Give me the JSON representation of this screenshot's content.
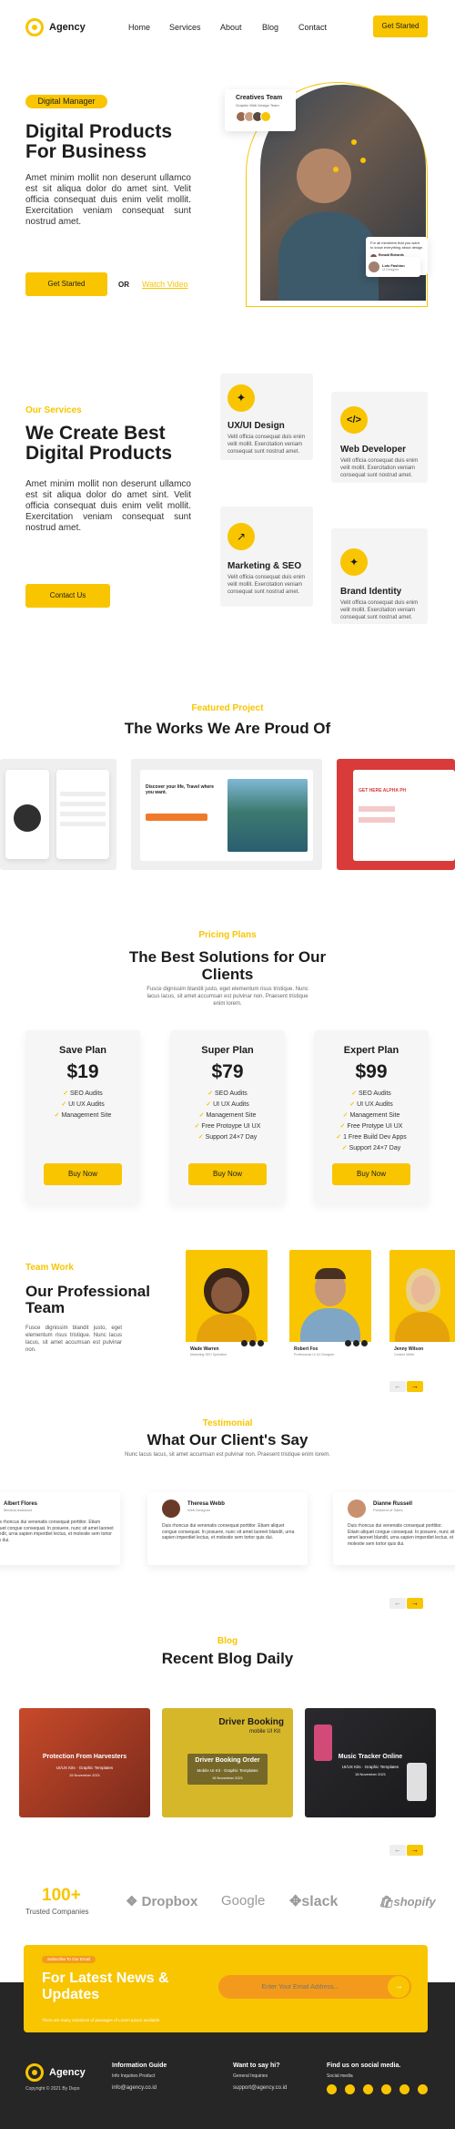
{
  "nav": {
    "brand": "Agency",
    "links": [
      "Home",
      "Services",
      "About",
      "Blog",
      "Contact"
    ],
    "cta": "Get Started"
  },
  "hero": {
    "badge": "Digital Manager",
    "title_line1": "Digital Products",
    "title_line2": "For Business",
    "description": "Amet minim mollit non deserunt ullamco est sit aliqua dolor do amet sint. Velit officia consequat duis enim velit mollit. Exercitation veniam consequat sunt nostrud amet.",
    "primary_btn": "Get Started",
    "or": "OR",
    "video_link": "Watch Video",
    "team_card_title": "Creatives Team",
    "team_card_subtitle": "Graphic Web Design Team",
    "quote_text": "For all members that you want to know everything about design",
    "quote_name": "Ronald Richards",
    "quote_role": "Designer",
    "small_card_name": "Lois Fashion",
    "small_card_role": "Ui Designer"
  },
  "services": {
    "eyebrow": "Our Services",
    "title_line1": "We Create Best",
    "title_line2": "Digital Products",
    "description": "Amet minim mollit non deserunt ullamco est sit aliqua dolor do amet sint. Velit officia consequat duis enim velit mollit. Exercitation veniam consequat sunt nostrud amet.",
    "cta": "Contact Us",
    "items": [
      {
        "title": "UX/UI Design",
        "desc": "Velit officia consequat duis enim velit mollit. Exercitation veniam consequat sunt nostrud amet."
      },
      {
        "title": "Web Developer",
        "desc": "Velit officia consequat duis enim velit mollit. Exercitation veniam consequat sunt nostrud amet."
      },
      {
        "title": "Marketing & SEO",
        "desc": "Velit officia consequat duis enim velit mollit. Exercitation veniam consequat sunt nostrud amet."
      },
      {
        "title": "Brand Identity",
        "desc": "Velit officia consequat duis enim velit mollit. Exercitation veniam consequat sunt nostrud amet."
      }
    ]
  },
  "works": {
    "eyebrow": "Featured Project",
    "title": "The Works We Are Proud Of",
    "card2_heading": "Discover your life, Travel where you want.",
    "card3_heading": "GET HERE ALPHA PH"
  },
  "pricing": {
    "eyebrow": "Pricing Plans",
    "title_line1": "The Best Solutions for Our",
    "title_line2": "Clients",
    "description": "Fusce dignissim blandit justo, eget elementum risus tristique. Nunc lacus lacus, sit amet accumsan est pulvinar non. Praesent tristique enim lorem.",
    "plans": [
      {
        "name": "Save Plan",
        "price": "$19",
        "features": [
          "SEO Audits",
          "UI UX Audits",
          "Management Site"
        ],
        "button": "Buy Now"
      },
      {
        "name": "Super Plan",
        "price": "$79",
        "features": [
          "SEO Audits",
          "UI UX Audits",
          "Management Site",
          "Free Protoype UI UX",
          "Support 24×7 Day"
        ],
        "button": "Buy Now"
      },
      {
        "name": "Expert Plan",
        "price": "$99",
        "features": [
          "SEO Audits",
          "UI UX Audits",
          "Management Site",
          "Free Protype UI UX",
          "1 Free Build Dev Apps",
          "Support 24×7 Day"
        ],
        "button": "Buy Now"
      }
    ]
  },
  "team": {
    "eyebrow": "Team Work",
    "title_line1": "Our Professional",
    "title_line2": "Team",
    "description": "Fusce dignissim blandit justo, eget elementum risus tristique. Nunc lacus lacus, sit amet accumsan est pulvinar non.",
    "members": [
      {
        "name": "Wade Warren",
        "role": "Marketing SEO Specialist"
      },
      {
        "name": "Robert Fox",
        "role": "Professional UI UX Designer"
      },
      {
        "name": "Jenny Wilson",
        "role": "Content Writer"
      }
    ]
  },
  "testimonials": {
    "eyebrow": "Testimonial",
    "title": "What Our Client's Say",
    "description": "Nunc lacus lacus, sit amet accumsan est pulvinar non. Praesent tristique enim lorem.",
    "items": [
      {
        "name": "Albert Flores",
        "role": "Medical Assistant",
        "text": "Duis rhoncus dui venenatis consequat porttitor. Etiam aliquet congue consequat. In posuere, nunc sit amet laoreet blandit, urna sapien imperdiet lectus, et molestie sem tortor quis dui."
      },
      {
        "name": "Theresa Webb",
        "role": "Web Designer",
        "text": "Duis rhoncus dui venenatis consequat porttitor. Etiam aliquet congue consequat. In posuere, nunc sit amet laoreet blandit, urna sapien imperdiet lectus, et molestie sem tortor quis dui."
      },
      {
        "name": "Dianne Russell",
        "role": "President of Sales",
        "text": "Duis rhoncus dui venenatis consequat porttitor. Etiam aliquet congue consequat. In posuere, nunc sit amet laoreet blandit, urna sapien imperdiet lectus, et molestie sem tortor quis dui."
      }
    ]
  },
  "blog": {
    "eyebrow": "Blog",
    "title": "Recent Blog Daily",
    "posts": [
      {
        "title": "Protection From Harvesters",
        "category": "UI/UX Kits",
        "tag": "Graphic Templates",
        "date": "15 November 2021"
      },
      {
        "title": "Driver Booking Order",
        "category": "Mobile UI Kit",
        "tag": "Graphic Templates",
        "date": "16 November 2021",
        "banner": "Driver Booking",
        "banner_sub": "mobile UI Kit"
      },
      {
        "title": "Music Tracker Online",
        "category": "UI/UX Kits",
        "tag": "Graphic Templates",
        "date": "18 November 2021"
      }
    ]
  },
  "clients": {
    "count": "100+",
    "label": "Trusted Companies",
    "logos": [
      "Dropbox",
      "Google",
      "slack",
      "shopify"
    ]
  },
  "newsletter": {
    "badge": "Subscribe To Our Email",
    "title_line1": "For Latest News &",
    "title_line2": "Updates",
    "subtitle": "There are many variations of passages of Lorem Ipsum available",
    "placeholder": "Enter Your Email Address..."
  },
  "footer": {
    "brand": "Agency",
    "copyright": "Copyright © 2021 By Depo",
    "col1_title": "Information Guide",
    "col1_sub": "Info Inquiries Product",
    "col1_link": "info@agency.co.id",
    "col2_title": "Want to say hi?",
    "col2_sub": "General Inquiries",
    "col2_link": "support@agency.co.id",
    "col3_title": "Find us on social media.",
    "col3_sub": "Social media"
  },
  "colors": {
    "accent": "#f8c500",
    "dark": "#262626",
    "text": "#1c1c1c"
  }
}
